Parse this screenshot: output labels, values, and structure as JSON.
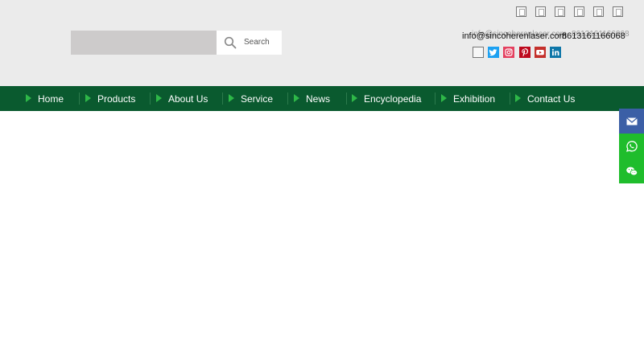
{
  "search": {
    "placeholder": "",
    "button_label": "Search"
  },
  "lang_flags": [
    "flag-icon",
    "flag-icon",
    "flag-icon",
    "flag-icon",
    "flag-icon",
    "flag-icon"
  ],
  "contact": {
    "email": "info@sincoherenlaser.com",
    "phone": "8613161166068"
  },
  "social": [
    {
      "icon": "flag-icon",
      "color": "#f5f5f5"
    },
    {
      "icon": "twitter-icon",
      "color": "#1da1f2"
    },
    {
      "icon": "instagram-icon",
      "color": "#e4405f"
    },
    {
      "icon": "pinterest-icon",
      "color": "#bd081c"
    },
    {
      "icon": "youtube-icon",
      "color": "#c4302b"
    },
    {
      "icon": "linkedin-icon",
      "color": "#0e76a8"
    }
  ],
  "nav": {
    "items": [
      {
        "label": "Home"
      },
      {
        "label": "Products"
      },
      {
        "label": "About Us"
      },
      {
        "label": "Service"
      },
      {
        "label": "News"
      },
      {
        "label": "Encyclopedia"
      },
      {
        "label": "Exhibition"
      },
      {
        "label": "Contact Us"
      }
    ]
  },
  "side_buttons": [
    {
      "icon": "email-icon",
      "color": "#3b5fa6"
    },
    {
      "icon": "whatsapp-icon",
      "color": "#1fbd2c"
    },
    {
      "icon": "wechat-icon",
      "color": "#1fbd2c"
    }
  ],
  "colors": {
    "nav_bg": "#0a5a2f",
    "header_bg": "#ebebeb",
    "accent": "#2eb848"
  }
}
